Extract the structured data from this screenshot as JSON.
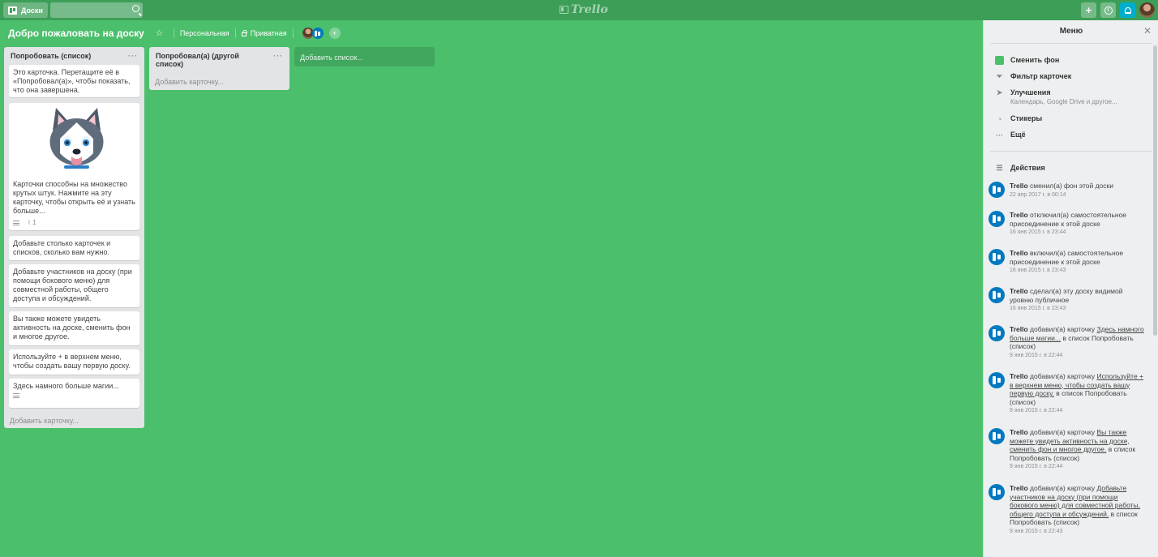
{
  "header": {
    "boards_label": "Доски",
    "search_placeholder": "",
    "logo_text": "Trello",
    "add_label": "+",
    "info_label": "i"
  },
  "board": {
    "title": "Добро пожаловать на доску",
    "visibility_team": "Персональная",
    "visibility_private": "Приватная"
  },
  "lists": [
    {
      "title": "Попробовать (список)",
      "menu": "···",
      "cards": [
        {
          "text": "Это карточка. Перетащите её в «Попробовал(а)», чтобы показать, что она завершена."
        },
        {
          "text": "Карточки способны на множество крутых штук. Нажмите на эту карточку, чтобы открыть её и узнать больше...",
          "attachments": "1"
        },
        {
          "text": "Добавьте столько карточек и списков, сколько вам нужно."
        },
        {
          "text": "Добавьте участников на доску (при помощи бокового меню) для совместной работы, общего доступа и обсуждений."
        },
        {
          "text": "Вы также можете увидеть активность на доске, сменить фон и многое другое."
        },
        {
          "text": "Используйте + в верхнем меню, чтобы создать вашу первую доску."
        },
        {
          "text": "Здесь намного больше магии..."
        }
      ],
      "add_card": "Добавить карточку..."
    },
    {
      "title": "Попробовал(а) (другой список)",
      "menu": "···",
      "cards": [],
      "add_card": "Добавить карточку..."
    }
  ],
  "add_list": "Добавить список...",
  "sidebar": {
    "title": "Меню",
    "close": "✕",
    "items": [
      {
        "label": "Сменить фон",
        "icon": "color-square-icon"
      },
      {
        "label": "Фильтр карточек",
        "icon": "filter-icon"
      },
      {
        "label": "Улучшения",
        "sub": "Календарь, Google Drive и другое...",
        "icon": "rocket-icon"
      },
      {
        "label": "Стикеры",
        "icon": "sticker-icon"
      },
      {
        "label": "Ещё",
        "icon": "more-icon"
      }
    ],
    "activity_title": "Действия",
    "activity": [
      {
        "user": "Trello",
        "text": " сменил(а) фон этой доски",
        "date": "22 апр 2017 г. в 00:14"
      },
      {
        "user": "Trello",
        "text": " отключил(а) самостоятельное присоединение к этой доске",
        "date": "16 янв 2015 г. в 23:44"
      },
      {
        "user": "Trello",
        "text": " включил(а) самостоятельное присоединение к этой доске",
        "date": "16 янв 2015 г. в 23:43"
      },
      {
        "user": "Trello",
        "text": " сделал(а) эту доску видимой уровню публичное",
        "date": "16 янв 2015 г. в 23:43"
      },
      {
        "user": "Trello",
        "text": " добавил(а) карточку ",
        "link": "Здесь намного больше магии...",
        "tail": " в список Попробовать (список)",
        "date": "9 янв 2015 г. в 22:44"
      },
      {
        "user": "Trello",
        "text": " добавил(а) карточку ",
        "link": "Используйте + в верхнем меню, чтобы создать вашу первую доску.",
        "tail": " в список Попробовать (список)",
        "date": "9 янв 2015 г. в 22:44"
      },
      {
        "user": "Trello",
        "text": " добавил(а) карточку ",
        "link": "Вы также можете увидеть активность на доске, сменить фон и многое другое.",
        "tail": " в список Попробовать (список)",
        "date": "9 янв 2015 г. в 22:44"
      },
      {
        "user": "Trello",
        "text": " добавил(а) карточку ",
        "link": "Добавьте участников на доску (при помощи бокового меню) для совместной работы, общего доступа и обсуждений.",
        "tail": " в список Попробовать (список)",
        "date": "9 янв 2015 г. в 22:43"
      }
    ]
  },
  "colors": {
    "board_bg": "#4bbf6b",
    "header_bg": "#3d9e58",
    "trello_blue": "#0079bf",
    "bell_bg": "#00aecc"
  }
}
